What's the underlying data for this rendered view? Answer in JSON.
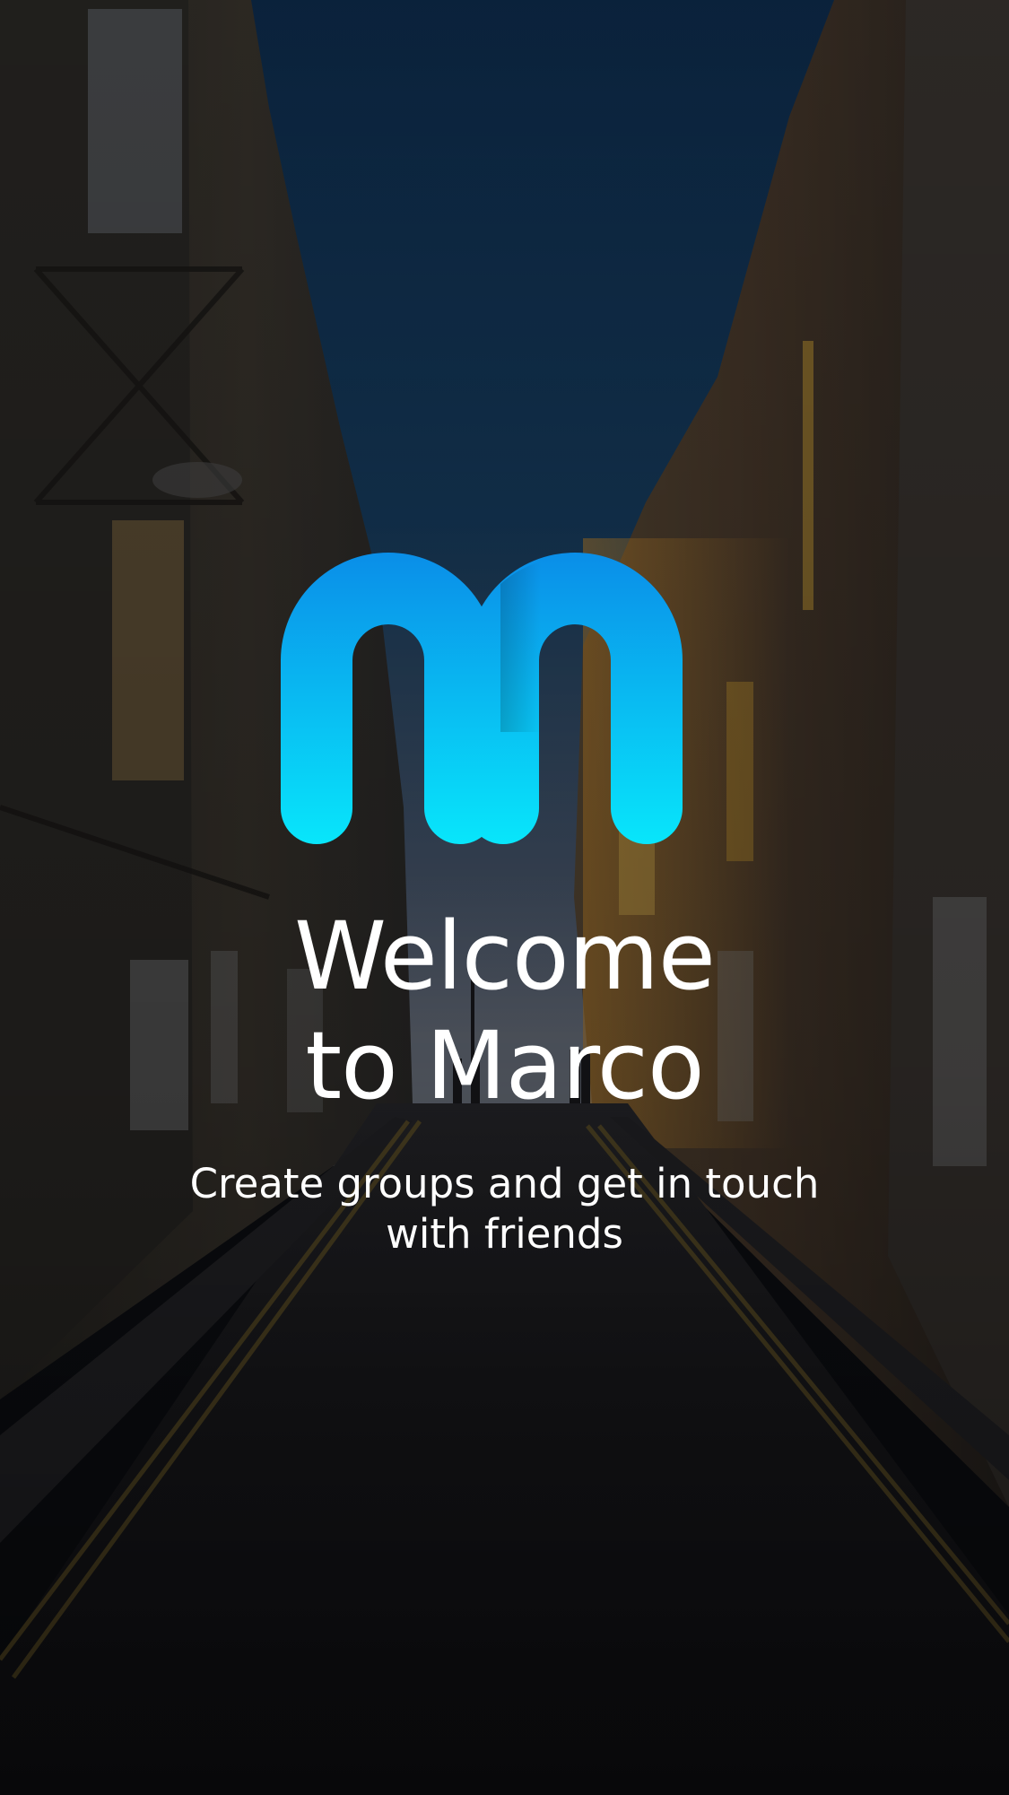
{
  "welcome": {
    "title_line1": "Welcome",
    "title_line2": "to Marco",
    "subtitle_line1": "Create groups and get in touch",
    "subtitle_line2": "with friends"
  },
  "brand": {
    "logo_icon": "marco-m-logo-icon",
    "logo_gradient_top": "#0a8ee8",
    "logo_gradient_bottom": "#08e6fb",
    "sky_top": "#0f3257",
    "sky_bottom": "#7a8190"
  }
}
